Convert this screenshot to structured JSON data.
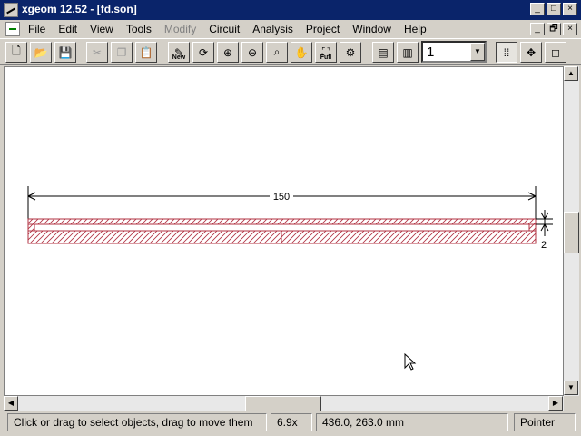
{
  "window": {
    "title": "xgeom 12.52 - [fd.son]",
    "buttons": [
      "_",
      "□",
      "×"
    ]
  },
  "menu": {
    "items": [
      {
        "label": "File",
        "enabled": true
      },
      {
        "label": "Edit",
        "enabled": true
      },
      {
        "label": "View",
        "enabled": true
      },
      {
        "label": "Tools",
        "enabled": true
      },
      {
        "label": "Modify",
        "enabled": false
      },
      {
        "label": "Circuit",
        "enabled": true
      },
      {
        "label": "Analysis",
        "enabled": true
      },
      {
        "label": "Project",
        "enabled": true
      },
      {
        "label": "Window",
        "enabled": true
      },
      {
        "label": "Help",
        "enabled": true
      }
    ],
    "mdi_buttons": [
      "_",
      "🗗",
      "×"
    ]
  },
  "toolbar": {
    "new_label": "New",
    "full_label": "Full",
    "layer_value": "1",
    "icons": {
      "new-file": "🗋",
      "open": "📂",
      "save": "💾",
      "cut": "✂",
      "copy": "❐",
      "paste": "📋",
      "new-metal": "✎",
      "rotate3d": "⟳",
      "zoom-in": "⊕",
      "zoom-out": "⊖",
      "zoom-window": "⌕",
      "pan": "✋",
      "zoom-full": "⛶",
      "query": "⚙",
      "layer-up": "▤",
      "layer-down": "▥",
      "grid": "⁞⁞",
      "move": "✥",
      "pointer": "◻"
    }
  },
  "drawing": {
    "width_dimension": "150",
    "height_dimension": "2"
  },
  "status": {
    "message": "Click or drag to select objects, drag to move them",
    "zoom": "6.9x",
    "coordinates": "436.0, 263.0 mm",
    "mode": "Pointer"
  }
}
